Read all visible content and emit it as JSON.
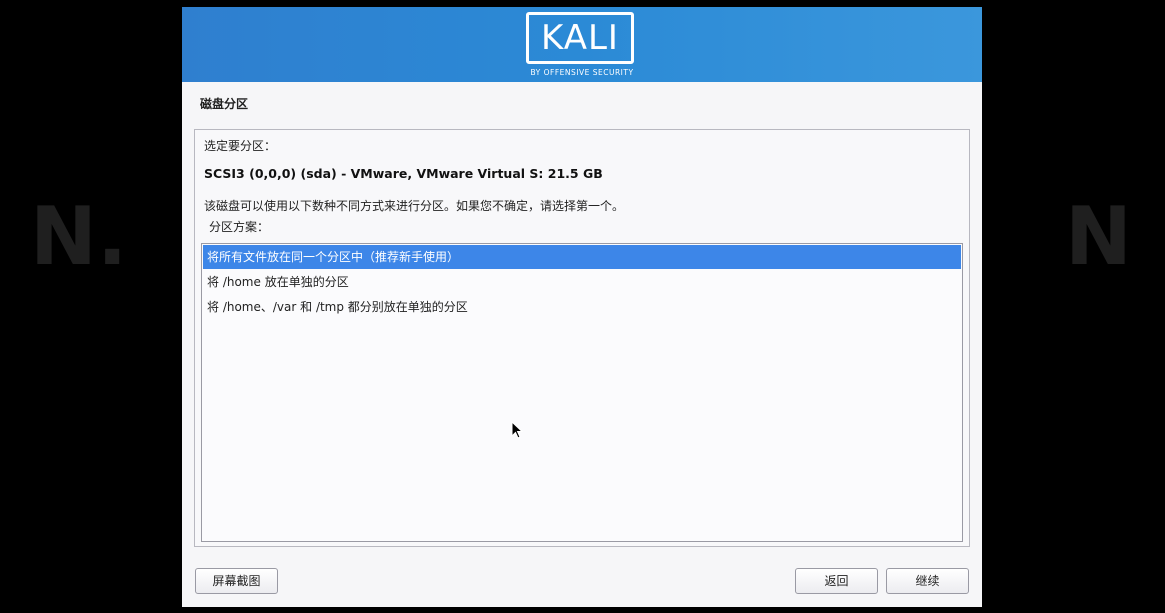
{
  "banner": {
    "logo_text": "KALI",
    "logo_subtitle": "BY OFFENSIVE SECURITY",
    "color": "#2f86d3"
  },
  "page": {
    "title": "磁盘分区"
  },
  "panel": {
    "prompt": "选定要分区：",
    "disk_label": "SCSI3 (0,0,0) (sda) - VMware, VMware Virtual S: 21.5 GB",
    "description": "该磁盘可以使用以下数种不同方式来进行分区。如果您不确定，请选择第一个。",
    "scheme_label": "分区方案："
  },
  "schemes": [
    {
      "label": "将所有文件放在同一个分区中（推荐新手使用）",
      "selected": true
    },
    {
      "label": "将 /home 放在单独的分区",
      "selected": false
    },
    {
      "label": "将 /home、/var 和 /tmp 都分别放在单独的分区",
      "selected": false
    }
  ],
  "buttons": {
    "screenshot": "屏幕截图",
    "back": "返回",
    "continue": "继续"
  },
  "colors": {
    "selection": "#3d86e8",
    "background": "#000000"
  }
}
